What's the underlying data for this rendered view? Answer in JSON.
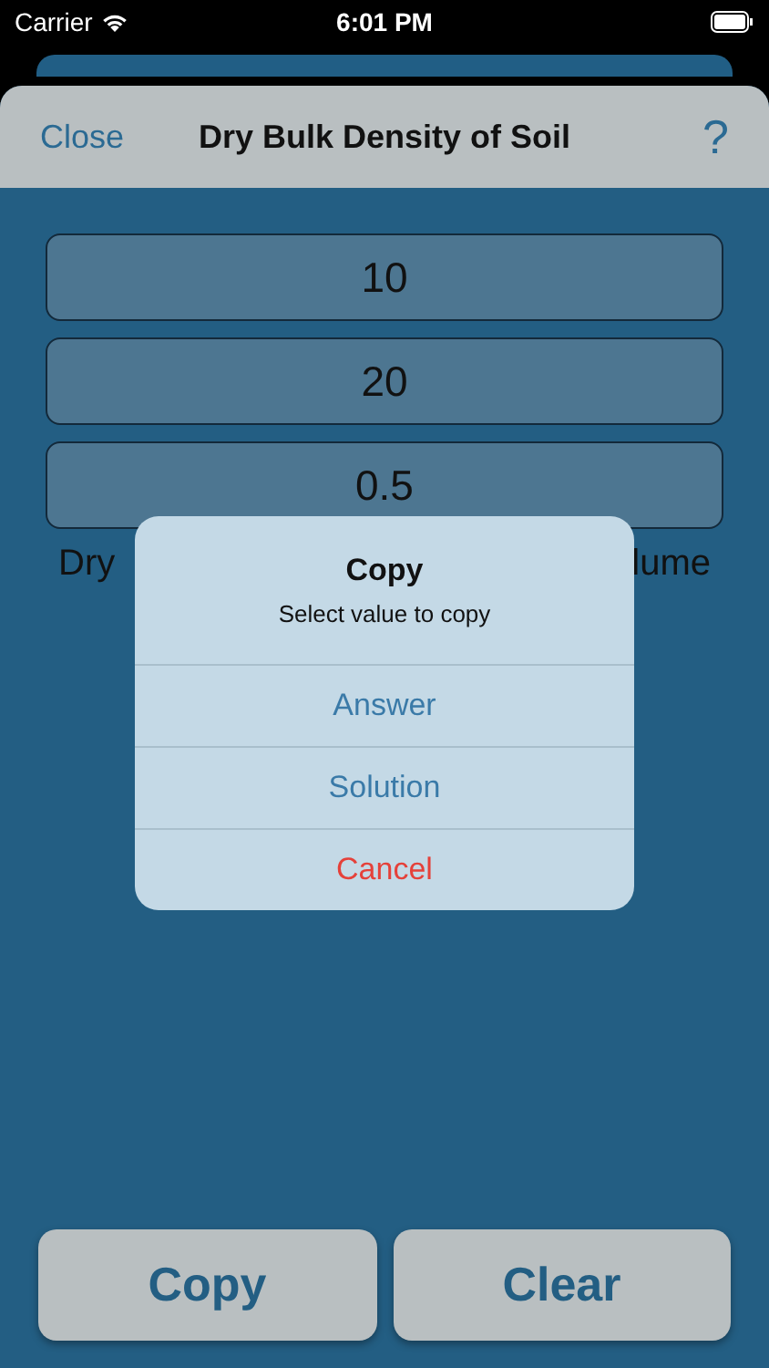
{
  "status_bar": {
    "carrier": "Carrier",
    "time": "6:01 PM"
  },
  "nav": {
    "close": "Close",
    "title": "Dry Bulk Density of Soil",
    "help": "?"
  },
  "fields": [
    {
      "value": "10"
    },
    {
      "value": "20"
    },
    {
      "value": "0.5"
    }
  ],
  "result_label": {
    "left_visible": "Dry",
    "right_visible": "lume"
  },
  "alert": {
    "title": "Copy",
    "message": "Select value to copy",
    "actions": [
      {
        "label": "Answer",
        "kind": "default"
      },
      {
        "label": "Solution",
        "kind": "default"
      },
      {
        "label": "Cancel",
        "kind": "destructive"
      }
    ]
  },
  "buttons": [
    "Copy",
    "Clear"
  ]
}
